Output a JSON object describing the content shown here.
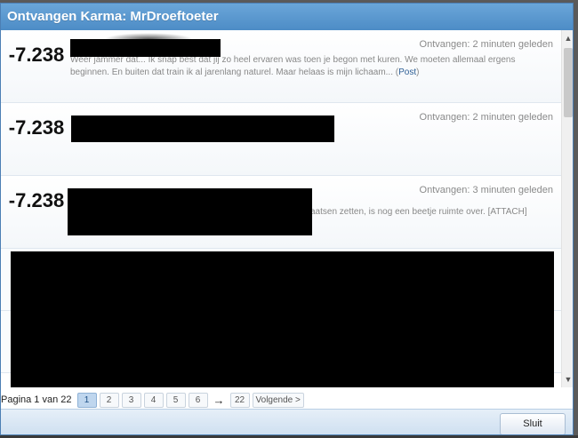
{
  "dialog": {
    "title": "Ontvangen Karma: MrDroeftoeter",
    "close_label": "Sluit"
  },
  "rows": [
    {
      "karma": "-7.238",
      "meta": "Ontvangen: 2 minuten geleden",
      "text_line1": "Weer jammer dat... Ik snap best dat jij zo heel ervaren was toen je begon met kuren. We moeten allemaal ergens",
      "text_line2": "beginnen. En buiten dat train ik al jarenlang naturel. Maar helaas is mijn lichaam... (",
      "post_link": "Post",
      "text_end": ")"
    },
    {
      "karma": "-7.238",
      "meta": "Ontvangen: 2 minuten geleden"
    },
    {
      "karma": "-7.238",
      "meta": "Ontvangen: 3 minuten geleden",
      "text_tail": "aatsen zetten, is nog een beetje ruimte over. [ATTACH]"
    }
  ],
  "pagination": {
    "label": "Pagina 1 van 22",
    "pages": [
      "1",
      "2",
      "3",
      "4",
      "5",
      "6"
    ],
    "arrow": "→",
    "last": "22",
    "next": "Volgende >",
    "current": "1"
  },
  "scrollbar": {
    "up": "▲",
    "down": "▼"
  }
}
